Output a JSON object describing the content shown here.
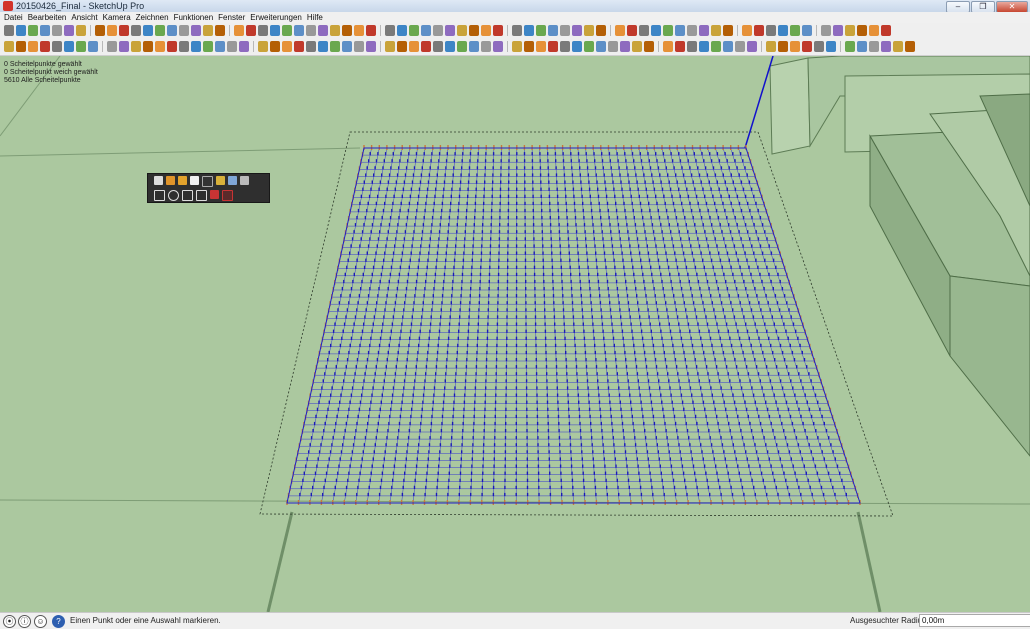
{
  "window": {
    "title": "20150426_Final - SketchUp Pro",
    "buttons": [
      "–",
      "❐",
      "✕"
    ]
  },
  "menubar": {
    "items": [
      "Datei",
      "Bearbeiten",
      "Ansicht",
      "Kamera",
      "Zeichnen",
      "Funktionen",
      "Fenster",
      "Erweiterungen",
      "Hilfe"
    ]
  },
  "viewport": {
    "info_lines": [
      "0 Scheitelpunkte gewählt",
      "0 Scheitelpunkt weich gewählt",
      "5610 Alle Scheitelpunkte"
    ]
  },
  "statusbar": {
    "hint": "Einen Punkt oder eine Auswahl markieren.",
    "measure_label": "Ausgesuchter Radius",
    "measure_value": "0,00m",
    "icons": [
      "geo-location-icon",
      "credits-icon",
      "user-icon",
      "help-icon"
    ]
  },
  "colors": {
    "ground": "#abc89f",
    "grid_line": "#2a2ad6",
    "edge_orange": "#c8773a",
    "axis_blue": "#1111cc",
    "building": "#9fbd96"
  }
}
